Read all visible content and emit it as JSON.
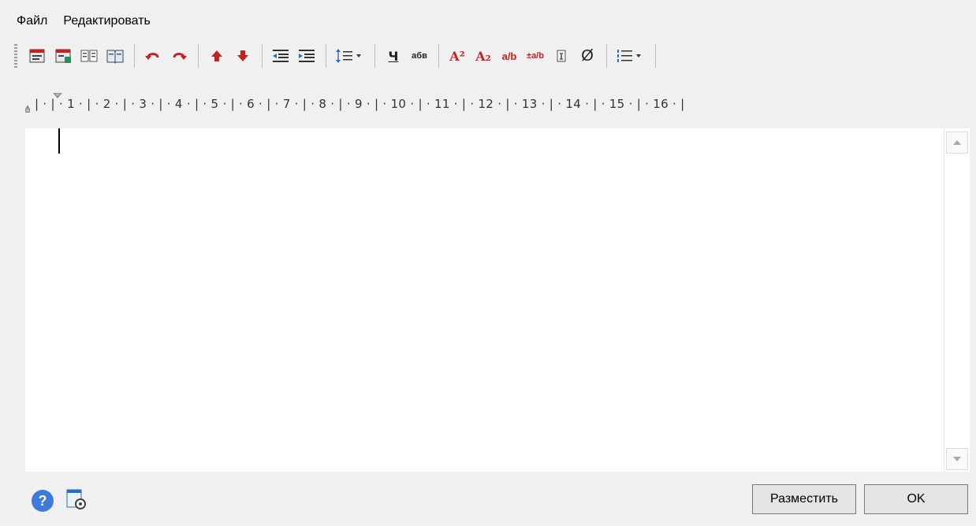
{
  "menu": {
    "items": [
      "Файл",
      "Редактировать"
    ]
  },
  "toolbar": {
    "underline_label": "Ч",
    "case_label": "абв",
    "superscript_label": "A²",
    "subscript_label": "A₂",
    "fraction_label": "a/b",
    "stack_label": "±a/b",
    "diameter_label": "Ø"
  },
  "ruler": {
    "text": "| · | · 1 · | · 2 · | · 3 · | · 4 · | · 5 · | · 6 · | · 7 · | · 8 · | · 9 · | · 10 · | · 11 · | · 12 · | · 13 · | · 14 · | · 15 · | · 16 · |"
  },
  "footer": {
    "place_label": "Разместить",
    "ok_label": "OK"
  },
  "colors": {
    "accent": "#c82020",
    "help": "#3d7bd8"
  }
}
